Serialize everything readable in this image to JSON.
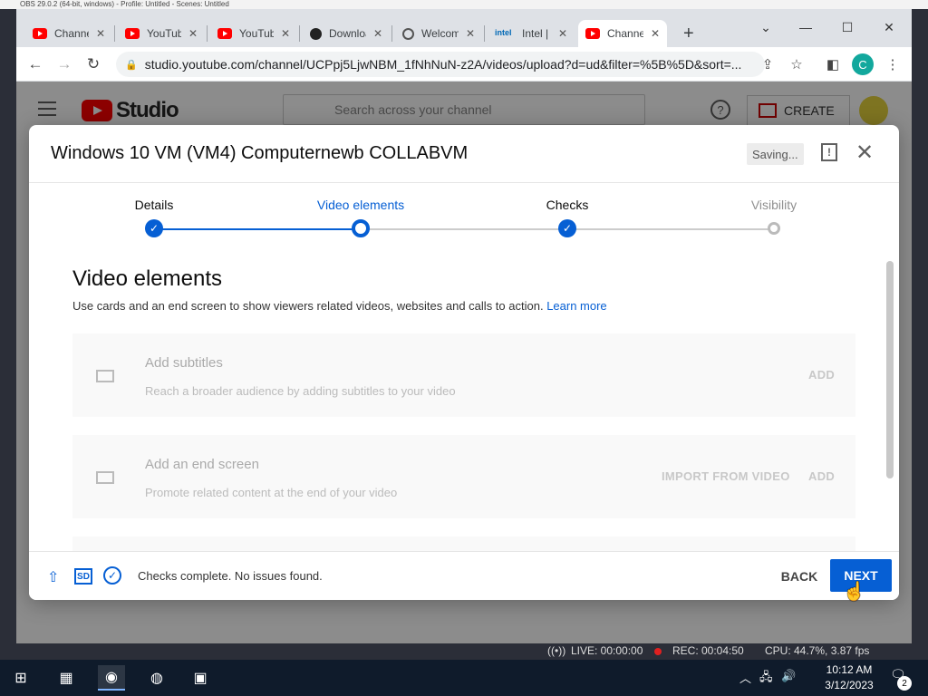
{
  "obs": {
    "title": "OBS 29.0.2 (64-bit, windows) - Profile: Untitled - Scenes: Untitled",
    "live": "LIVE: 00:00:00",
    "rec": "REC: 00:04:50",
    "cpu": "CPU: 44.7%, 3.87 fps"
  },
  "browser": {
    "tabs": [
      {
        "title": "Channel content",
        "favicon": "youtube-icon"
      },
      {
        "title": "YouTube",
        "favicon": "youtube-icon"
      },
      {
        "title": "YouTube",
        "favicon": "youtube-icon"
      },
      {
        "title": "Download",
        "favicon": "github-icon"
      },
      {
        "title": "Welcome",
        "favicon": "globe-icon"
      },
      {
        "title": "Intel | Data",
        "favicon": "intel-icon"
      },
      {
        "title": "Channel content",
        "favicon": "youtube-icon"
      }
    ],
    "url": "studio.youtube.com/channel/UCPpj5LjwNBM_1fNhNuN-z2A/videos/upload?d=ud&filter=%5B%5D&sort=...",
    "profile_initial": "C"
  },
  "studio": {
    "logo_text": "Studio",
    "search_placeholder": "Search across your channel",
    "help": "?",
    "create_label": "CREATE"
  },
  "dialog": {
    "title": "Windows 10 VM (VM4) Computernewb COLLABVM",
    "saving": "Saving...",
    "steps": [
      {
        "label": "Details",
        "state": "done"
      },
      {
        "label": "Video elements",
        "state": "current"
      },
      {
        "label": "Checks",
        "state": "done"
      },
      {
        "label": "Visibility",
        "state": "pending"
      }
    ],
    "section_title": "Video elements",
    "section_desc": "Use cards and an end screen to show viewers related videos, websites and calls to action.",
    "learn_more": "Learn more",
    "cards": [
      {
        "title": "Add subtitles",
        "desc": "Reach a broader audience by adding subtitles to your video",
        "buttons": [
          "ADD"
        ]
      },
      {
        "title": "Add an end screen",
        "desc": "Promote related content at the end of your video",
        "buttons": [
          "IMPORT FROM VIDEO",
          "ADD"
        ]
      }
    ],
    "footer": {
      "sd": "SD",
      "status": "Checks complete. No issues found.",
      "back": "BACK",
      "next": "NEXT"
    }
  },
  "taskbar": {
    "time": "10:12 AM",
    "date": "3/12/2023",
    "notifications": "2"
  },
  "colors": {
    "accent": "#065fd4",
    "youtube_red": "#ff0000"
  }
}
